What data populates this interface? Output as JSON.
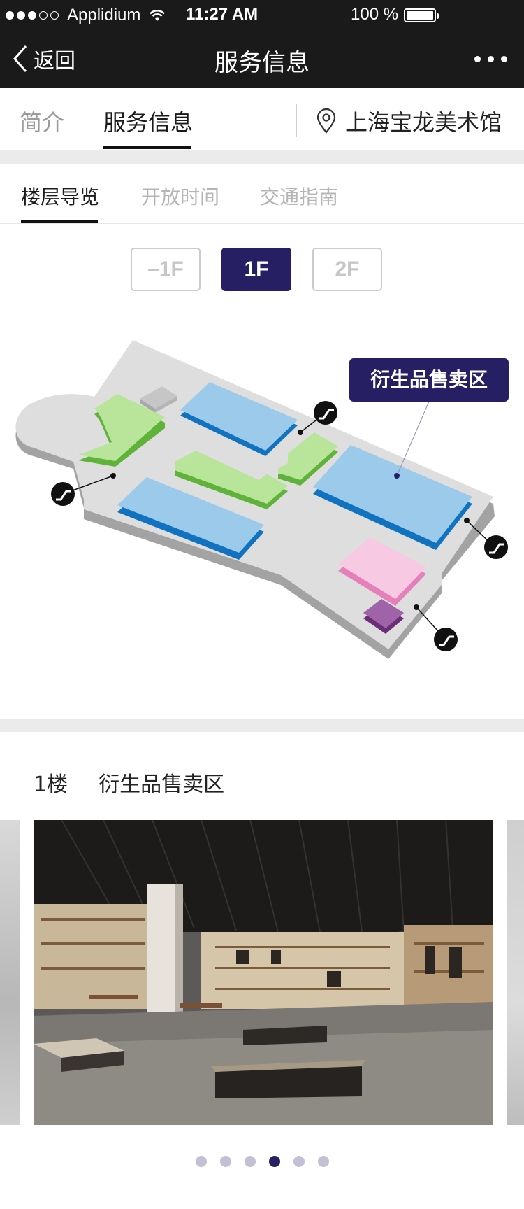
{
  "status_bar": {
    "carrier": "Applidium",
    "time": "11:27 AM",
    "battery": "100 %"
  },
  "nav": {
    "back_label": "返回",
    "title": "服务信息"
  },
  "top_tabs": [
    {
      "label": "简介",
      "active": false
    },
    {
      "label": "服务信息",
      "active": true
    }
  ],
  "location": {
    "name": "上海宝龙美术馆",
    "icon": "location-pin-icon"
  },
  "sub_tabs": [
    {
      "label": "楼层导览",
      "active": true
    },
    {
      "label": "开放时间",
      "active": false
    },
    {
      "label": "交通指南",
      "active": false
    }
  ],
  "floors": [
    {
      "label": "–1F",
      "active": false
    },
    {
      "label": "1F",
      "active": true
    },
    {
      "label": "2F",
      "active": false
    }
  ],
  "map": {
    "selected_label": "衍生品售卖区",
    "icon": "escalator-icon",
    "colors": {
      "blue": "#9ccaeb",
      "green": "#b8e59a",
      "pink": "#f7c9e3",
      "purple": "#9f63a8",
      "floor": "#dddddd"
    }
  },
  "area": {
    "floor": "1楼",
    "name": "衍生品售卖区"
  },
  "carousel": {
    "count": 6,
    "active_index": 3
  },
  "colors": {
    "accent": "#261f63",
    "nav_bg": "#1a1a1a"
  }
}
